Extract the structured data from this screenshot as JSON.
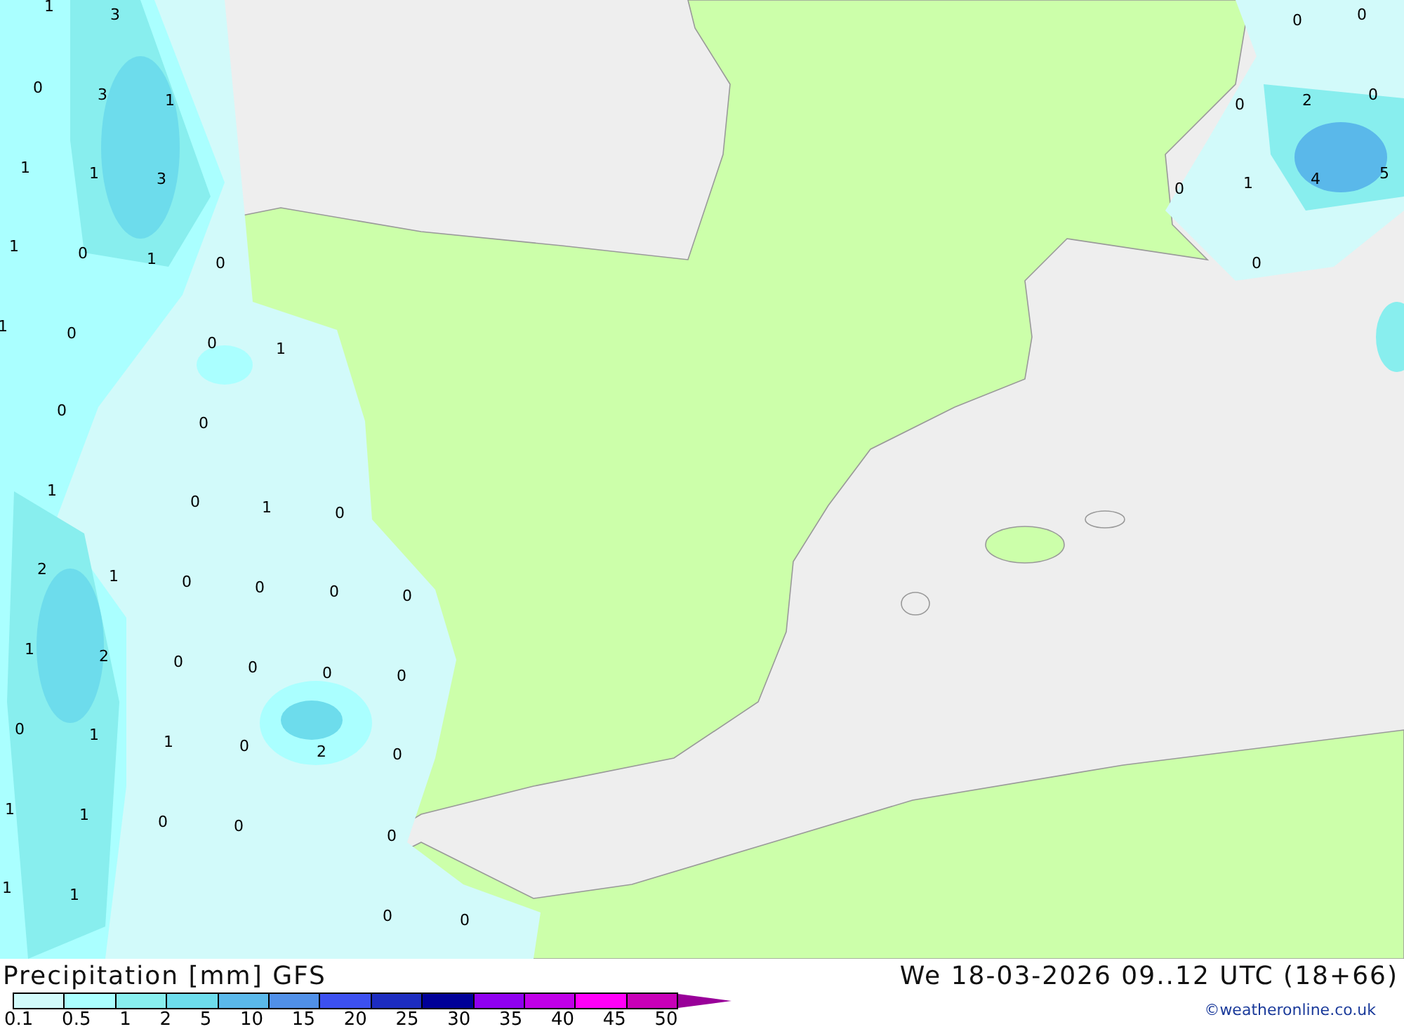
{
  "map": {
    "contour_labels": [
      "1",
      "3",
      "0",
      "3",
      "1",
      "1",
      "1",
      "3",
      "1",
      "0",
      "1",
      "0",
      "1",
      "0",
      "0",
      "1",
      "0",
      "0",
      "1",
      "0",
      "1",
      "0",
      "2",
      "1",
      "0",
      "0",
      "0",
      "0",
      "1",
      "2",
      "0",
      "0",
      "0",
      "0",
      "0",
      "1",
      "1",
      "0",
      "2",
      "0",
      "1",
      "1",
      "0",
      "0",
      "0",
      "1",
      "1",
      "0",
      "0",
      "0",
      "0",
      "0",
      "2",
      "0",
      "0",
      "1",
      "4",
      "5",
      "0"
    ]
  },
  "legend": {
    "title": "Precipitation [mm] GFS",
    "boxes": [
      {
        "color": "#d2fafa"
      },
      {
        "color": "#aaffff"
      },
      {
        "color": "#88eeee"
      },
      {
        "color": "#6ddcec"
      },
      {
        "color": "#5ab8ea"
      },
      {
        "color": "#5090e8"
      },
      {
        "color": "#3c50f0"
      },
      {
        "color": "#1c2cc0"
      },
      {
        "color": "#000098"
      },
      {
        "color": "#9000f0"
      },
      {
        "color": "#c000e8"
      },
      {
        "color": "#ff00f8"
      },
      {
        "color": "#c800b8"
      }
    ],
    "ticks": [
      "0.1",
      "0.5",
      "1",
      "2",
      "5",
      "10",
      "15",
      "20",
      "25",
      "30",
      "35",
      "40",
      "45",
      "50"
    ]
  },
  "valid_time": "We 18-03-2026 09..12 UTC (18+66)",
  "credit": "©weatheronline.co.uk"
}
